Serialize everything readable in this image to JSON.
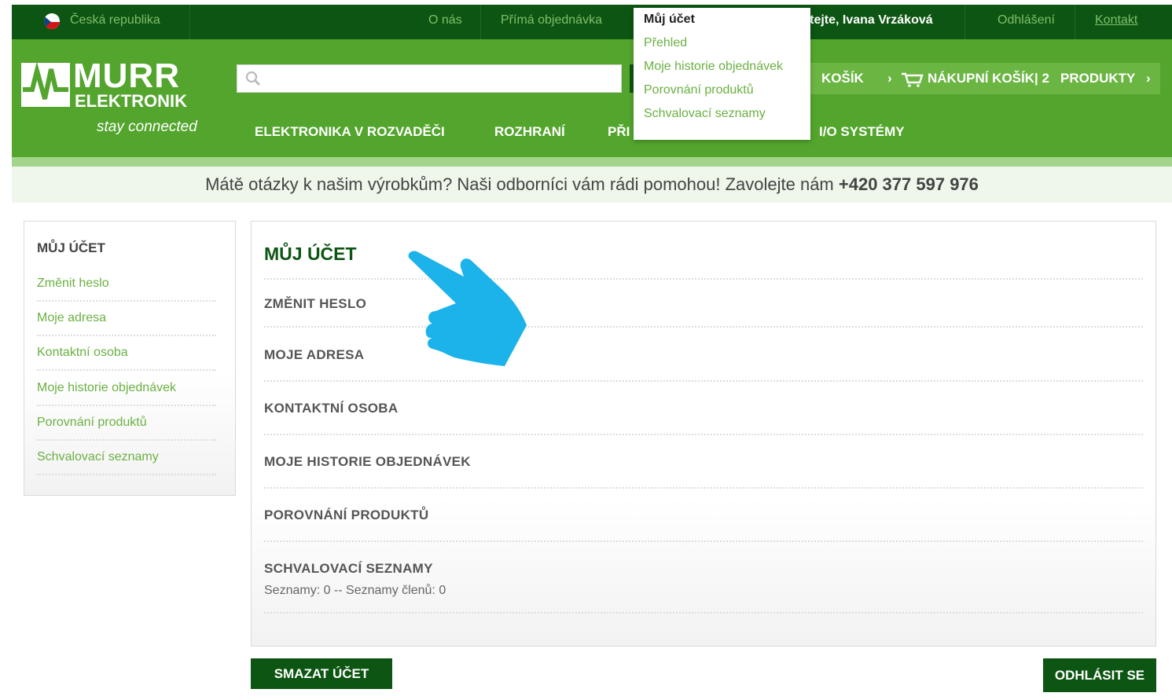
{
  "topbar": {
    "country": "Česká republika",
    "about": "O nás",
    "direct_order": "Přímá objednávka",
    "welcome": "Vítejte, Ivana Vrzáková",
    "logout": "Odhlášení",
    "contact": "Kontakt"
  },
  "account_menu": {
    "title": "Můj účet",
    "items": [
      "Přehled",
      "Moje historie objednávek",
      "Porovnání produktů",
      "Schvalovací seznamy"
    ]
  },
  "logo": {
    "brand": "MURR",
    "sub": "ELEKTRONIK",
    "tagline": "stay connected"
  },
  "search": {
    "placeholder": ""
  },
  "header_buttons": {
    "quick_cart": "KOŠÍK",
    "cart": "NÁKUPNÍ KOŠÍK",
    "cart_count": "| 2",
    "cart_unit": "PRODUKTY"
  },
  "nav": [
    "ELEKTRONIKA V ROZVADĚČI",
    "ROZHRANÍ",
    "PŘI",
    "I/O SYSTÉMY"
  ],
  "info": {
    "text": "Mátě otázky k našim výrobkům? Naši odborníci vám rádi pomohou! Zavolejte nám",
    "phone": "+420 377 597 976"
  },
  "sidebar": {
    "title": "MŮJ ÚČET",
    "items": [
      "Změnit heslo",
      "Moje adresa",
      "Kontaktní osoba",
      "Moje historie objednávek",
      "Porovnání produktů",
      "Schvalovací seznamy"
    ]
  },
  "main": {
    "title": "MŮJ ÚČET",
    "items": [
      "ZMĚNIT HESLO",
      "MOJE ADRESA",
      "KONTAKTNÍ OSOBA",
      "MOJE HISTORIE OBJEDNÁVEK",
      "POROVNÁNÍ PRODUKTŮ",
      "SCHVALOVACÍ SEZNAMY"
    ],
    "lists_info": "Seznamy: 0 -- Seznamy členů: 0"
  },
  "buttons": {
    "delete_account": "SMAZAT ÚČET",
    "logout": "ODHLÁSIT SE"
  },
  "colors": {
    "dark_green": "#0d5512",
    "green": "#53a52d",
    "link_green": "#6ab042",
    "hand_blue": "#1bb3ea"
  }
}
